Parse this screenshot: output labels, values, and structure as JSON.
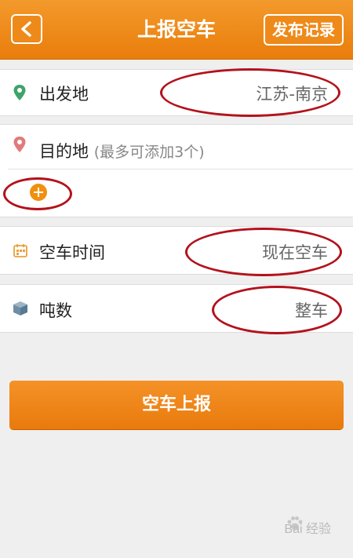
{
  "header": {
    "title": "上报空车",
    "back_icon": "chevron-left-icon",
    "record_label": "发布记录"
  },
  "form": {
    "departure": {
      "label": "出发地",
      "value": "江苏-南京",
      "icon": "location-pin-icon",
      "icon_color": "#3fa36a"
    },
    "destination": {
      "label": "目的地",
      "hint": "(最多可添加3个)",
      "icon": "location-pin-icon",
      "icon_color": "#e07b7b"
    },
    "add_destination_icon": "plus-circle-icon",
    "empty_time": {
      "label": "空车时间",
      "value": "现在空车",
      "icon": "calendar-icon"
    },
    "tonnage": {
      "label": "吨数",
      "value": "整车",
      "icon": "cube-icon"
    }
  },
  "submit": {
    "label": "空车上报"
  },
  "watermark": {
    "text": "Bai 经验"
  },
  "colors": {
    "accent": "#ee8a1a",
    "annotation": "#b3121c",
    "background": "#efefef"
  }
}
